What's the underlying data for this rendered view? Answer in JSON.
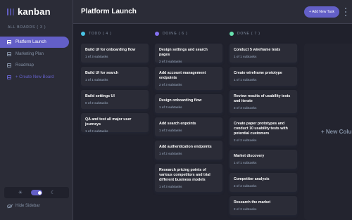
{
  "app": {
    "logo_text": "kanban"
  },
  "sidebar": {
    "boards_heading": "ALL BOARDS ( 3 )",
    "boards": [
      {
        "label": "Platform Launch",
        "active": true
      },
      {
        "label": "Marketing Plan",
        "active": false
      },
      {
        "label": "Roadmap",
        "active": false
      }
    ],
    "create_label": "+ Create New Board",
    "hide_label": "Hide Sidebar"
  },
  "header": {
    "title": "Platform Launch",
    "add_task_label": "+ Add New Task"
  },
  "colors": {
    "accent": "#635fc7",
    "todo": "#49c4e5",
    "doing": "#8471f2",
    "done": "#67e2ae"
  },
  "columns": [
    {
      "label": "TODO ( 4 )",
      "cards": [
        {
          "title": "Build UI for onboarding flow",
          "subtasks": "1 of 3 subtasks"
        },
        {
          "title": "Build UI for search",
          "subtasks": "1 of 1 subtasks"
        },
        {
          "title": "Build settings UI",
          "subtasks": "0 of 2 subtasks"
        },
        {
          "title": "QA and test all major user journeys",
          "subtasks": "1 of 2 subtasks"
        }
      ]
    },
    {
      "label": "DOING ( 6 )",
      "cards": [
        {
          "title": "Design settings and search pages",
          "subtasks": "2 of 3 subtasks"
        },
        {
          "title": "Add account management endpoints",
          "subtasks": "2 of 3 subtasks"
        },
        {
          "title": "Design onboarding flow",
          "subtasks": "1 of 3 subtasks"
        },
        {
          "title": "Add search enpoints",
          "subtasks": "1 of 2 subtasks"
        },
        {
          "title": "Add authentication endpoints",
          "subtasks": "1 of 2 subtasks"
        },
        {
          "title": "Research pricing points of various competitors and trial different business models",
          "subtasks": "1 of 3 subtasks"
        }
      ]
    },
    {
      "label": "DONE ( 7 )",
      "cards": [
        {
          "title": "Conduct 5 wireframe tests",
          "subtasks": "1 of 1 subtasks"
        },
        {
          "title": "Create wireframe prototype",
          "subtasks": "1 of 1 subtasks"
        },
        {
          "title": "Review results of usability tests and iterate",
          "subtasks": "3 of 3 subtasks"
        },
        {
          "title": "Create paper prototypes and conduct 10 usability tests with potential customers",
          "subtasks": "2 of 2 subtasks"
        },
        {
          "title": "Market discovery",
          "subtasks": "1 of 1 subtasks"
        },
        {
          "title": "Competitor analysis",
          "subtasks": "2 of 2 subtasks"
        },
        {
          "title": "Research the market",
          "subtasks": "2 of 2 subtasks"
        }
      ]
    }
  ],
  "new_column_label": "+ New Column"
}
